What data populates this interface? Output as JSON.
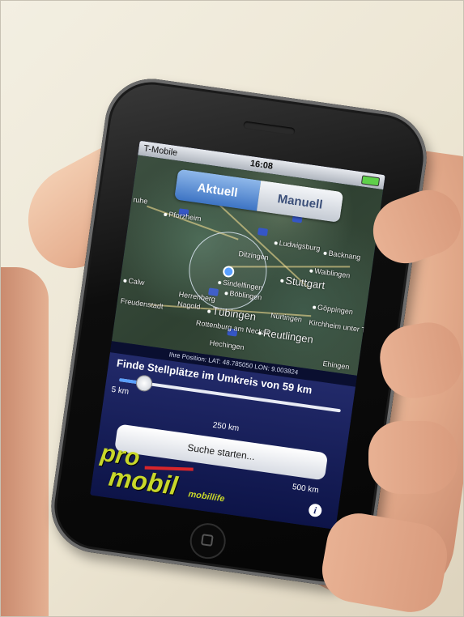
{
  "statusbar": {
    "carrier": "T-Mobile",
    "time": "16:08",
    "signal_icon": "signal-icon",
    "battery_icon": "battery-icon"
  },
  "tabs": [
    {
      "label": "Aktuell",
      "active": true
    },
    {
      "label": "Manuell",
      "active": false
    }
  ],
  "map": {
    "cities": {
      "pforzheim": "Pforzheim",
      "stuttgart": "Stuttgart",
      "tuebingen": "Tübingen",
      "reutlingen": "Reutlingen",
      "ludwigsburg": "Ludwigsburg",
      "backnang": "Backnang",
      "waiblingen": "Waiblingen",
      "boeblingen": "Böblingen",
      "sindelfingen": "Sindelfingen",
      "goeppingen": "Göppingen",
      "nuertingen": "Nürtingen",
      "karlsruhe": "ruhe",
      "herrenberg": "Herrenberg",
      "rottenburg": "Rottenburg am Neckar",
      "ditzingen": "Ditzingen",
      "kirchheim": "Kirchheim unter Teck",
      "freudenstadt": "Freudenstadt",
      "calw": "Calw",
      "nagold": "Nagold",
      "hechingen": "Hechingen",
      "ehingen": "Ehingen"
    }
  },
  "position": {
    "label": "Ihre Position: LAT: 48.785050 LON: 9.003824"
  },
  "search": {
    "label": "Finde Stellplätze im Umkreis von 59 km",
    "slider": {
      "min_label": "5 km",
      "mid_label": "250 km",
      "max_label": "500 km",
      "value_km": 59,
      "min_km": 5,
      "max_km": 500
    },
    "start_button": "Suche starten..."
  },
  "branding": {
    "logo_line1": "pro",
    "logo_line2": "mobil",
    "sublogo": "mobillife",
    "info_icon": "i"
  },
  "colors": {
    "screen_bg": "#0e1545",
    "active_tab": "#3d74c4",
    "logo": "#c8d72a",
    "logo_stripe": "#d9252a"
  }
}
